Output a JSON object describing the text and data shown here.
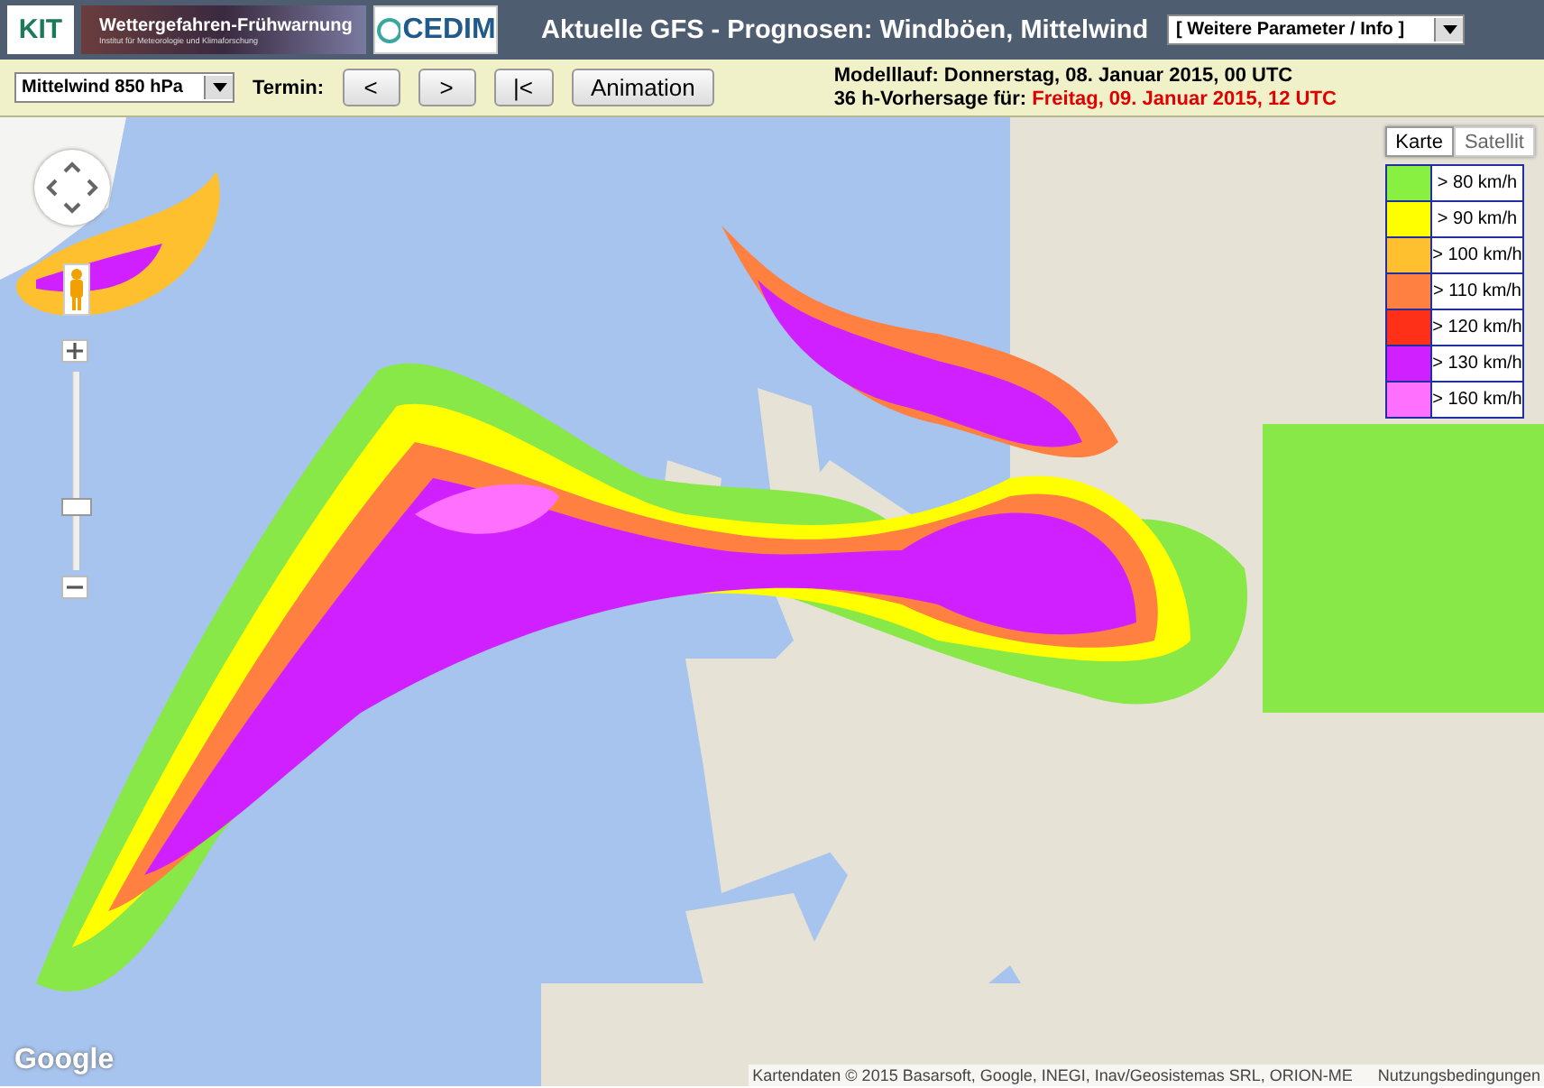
{
  "header": {
    "logos": {
      "kit": "KIT",
      "banner_title": "Wettergefahren-Frühwarnung",
      "banner_subtitle": "Institut für Meteorologie und Klimaforschung",
      "cedim": "CEDIM"
    },
    "title": "Aktuelle GFS - Prognosen: Windböen, Mittelwind",
    "parameter_menu": "[ Weitere Parameter / Info ]"
  },
  "toolbar": {
    "level_select": "Mittelwind 850 hPa",
    "termin_label": "Termin:",
    "buttons": [
      "<",
      ">",
      "|<",
      "Animation"
    ],
    "model_run": {
      "label": "Modelllauf:",
      "value": "Donnerstag, 08. Januar 2015, 00 UTC"
    },
    "forecast": {
      "label": "36 h-Vorhersage für:",
      "value": "Freitag, 09. Januar 2015, 12 UTC"
    }
  },
  "map": {
    "map_types": [
      {
        "label": "Karte",
        "selected": true
      },
      {
        "label": "Satellit",
        "selected": false
      }
    ],
    "zoom": {
      "level": 0.3
    },
    "legend": [
      {
        "label": "> 80 km/h",
        "color": "#88f040"
      },
      {
        "label": "> 90 km/h",
        "color": "#ffff00"
      },
      {
        "label": "> 100 km/h",
        "color": "#ffc030"
      },
      {
        "label": "> 110 km/h",
        "color": "#ff8040"
      },
      {
        "label": "> 120 km/h",
        "color": "#ff3018"
      },
      {
        "label": "> 130 km/h",
        "color": "#d020ff"
      },
      {
        "label": "> 160 km/h",
        "color": "#ff70ff"
      }
    ],
    "google_logo": "Google",
    "attribution": "Kartendaten © 2015 Basarsoft, Google, INEGI, Inav/Geosistemas SRL, ORION-ME",
    "terms_link": "Nutzungsbedingungen"
  }
}
